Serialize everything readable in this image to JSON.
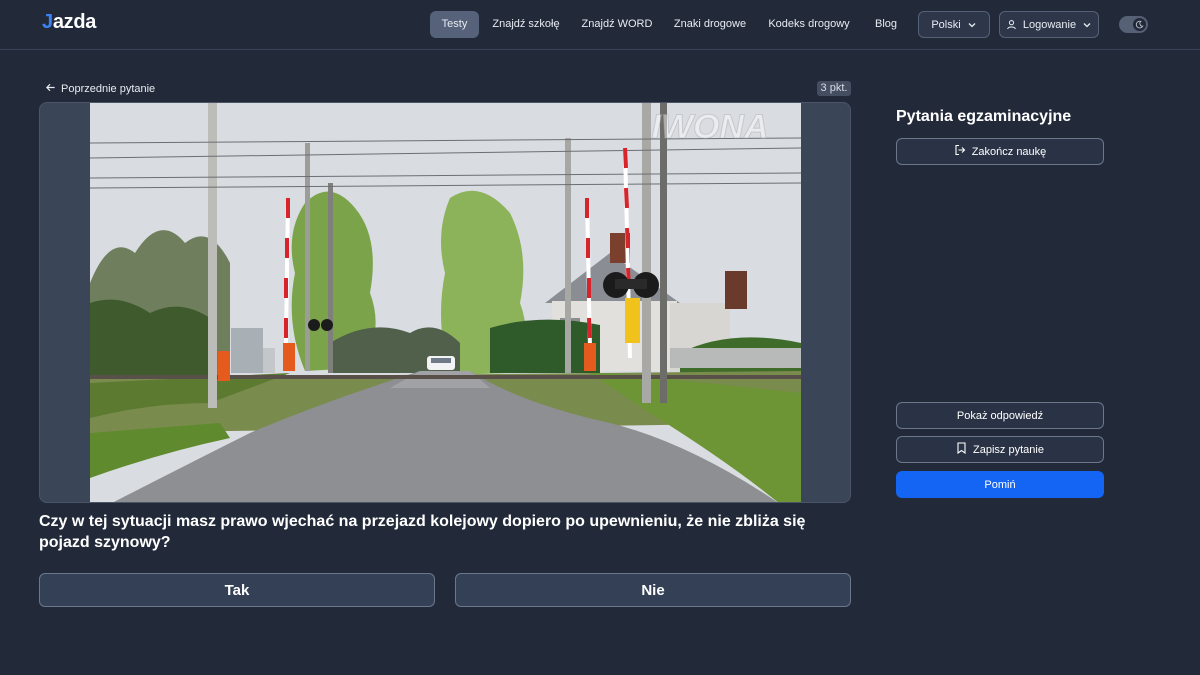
{
  "header": {
    "logo_mark": "J",
    "logo_rest": "azda",
    "nav": [
      {
        "label": "Testy",
        "active": true
      },
      {
        "label": "Znajdź szkołę",
        "active": false
      },
      {
        "label": "Znajdź WORD",
        "active": false
      },
      {
        "label": "Znaki drogowe",
        "active": false
      },
      {
        "label": "Kodeks drogowy",
        "active": false
      },
      {
        "label": "Blog",
        "active": false
      }
    ],
    "language": "Polski",
    "login": "Logowanie",
    "theme_toggle_icon": "moon-icon"
  },
  "question_view": {
    "back_label": "Poprzednie pytanie",
    "points": "3 pkt.",
    "photo_watermark": "IWONA",
    "question_text": "Czy w tej sytuacji masz prawo wjechać na przejazd kolejowy dopiero po upewnieniu, że nie zbliża się pojazd szynowy?",
    "answers": [
      "Tak",
      "Nie"
    ]
  },
  "sidebar": {
    "title": "Pytania egzaminacyjne",
    "end_learning": "Zakończ naukę",
    "show_answer": "Pokaż odpowiedź",
    "save_question": "Zapisz pytanie",
    "skip": "Pomiń"
  },
  "colors": {
    "background": "#222a3a",
    "accent": "#1565f5",
    "active_nav": "#55627a"
  }
}
